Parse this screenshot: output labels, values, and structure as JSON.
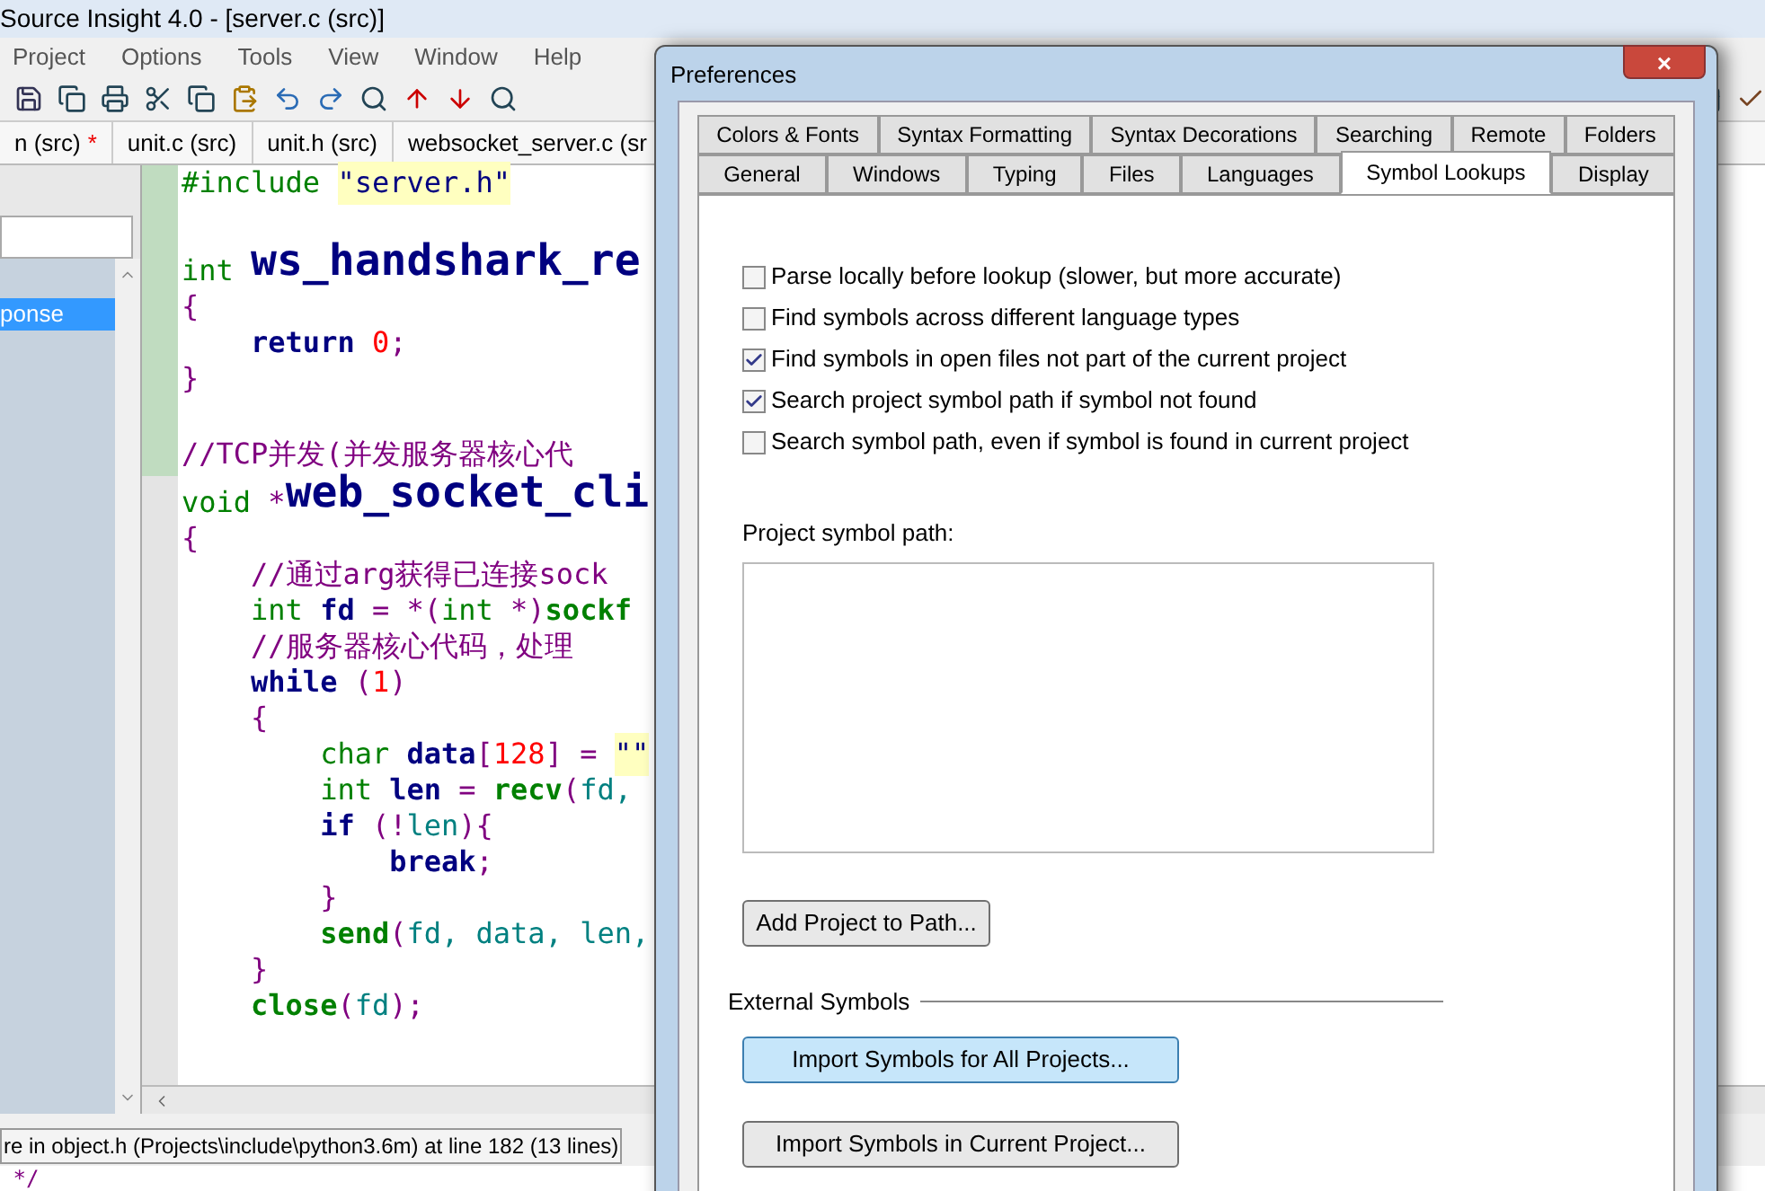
{
  "app": {
    "title": "Source Insight 4.0 - [server.c (src)]",
    "menu": [
      "Project",
      "Options",
      "Tools",
      "View",
      "Window",
      "Help"
    ],
    "file_tabs": [
      {
        "label": "n (src)",
        "marker": "*"
      },
      {
        "label": "unit.c (src)"
      },
      {
        "label": "unit.h (src)"
      },
      {
        "label": "websocket_server.c (sr"
      }
    ],
    "symbol_list": [
      {
        "label": "ponse",
        "selected": true
      }
    ],
    "code_lines": [
      {
        "segments": [
          {
            "kind": "keyword",
            "text": "#include "
          },
          {
            "kind": "string",
            "text": "\"server.h\""
          }
        ]
      },
      {
        "kind": "blank"
      },
      {
        "segments": [
          {
            "kind": "keyword",
            "text": "int "
          },
          {
            "kind": "function",
            "text": "ws_handshark_re"
          }
        ]
      },
      {
        "segments": [
          {
            "kind": "punct",
            "text": "{"
          }
        ]
      },
      {
        "segments": [
          {
            "kind": "bold",
            "text": "    return "
          },
          {
            "kind": "number",
            "text": "0"
          },
          {
            "kind": "punct",
            "text": ";"
          }
        ]
      },
      {
        "segments": [
          {
            "kind": "punct",
            "text": "}"
          }
        ]
      },
      {
        "kind": "blank"
      },
      {
        "segments": [
          {
            "kind": "comment",
            "text": "//TCP并发(并发服务器核心代"
          }
        ]
      },
      {
        "segments": [
          {
            "kind": "keyword",
            "text": "void "
          },
          {
            "kind": "punct",
            "text": "*"
          },
          {
            "kind": "function",
            "text": "web_socket_cli"
          }
        ]
      },
      {
        "segments": [
          {
            "kind": "punct",
            "text": "{"
          }
        ]
      },
      {
        "segments": [
          {
            "kind": "comment",
            "text": "    //通过arg获得已连接sock"
          }
        ]
      },
      {
        "segments": [
          {
            "kind": "keyword",
            "text": "    int "
          },
          {
            "kind": "bold",
            "text": "fd"
          },
          {
            "kind": "punct",
            "text": " = *("
          },
          {
            "kind": "keyword",
            "text": "int "
          },
          {
            "kind": "punct",
            "text": "*)"
          },
          {
            "kind": "call",
            "text": "sockf"
          }
        ]
      },
      {
        "segments": [
          {
            "kind": "comment",
            "text": "    //服务器核心代码，处理"
          }
        ]
      },
      {
        "segments": [
          {
            "kind": "bold",
            "text": "    while "
          },
          {
            "kind": "punct",
            "text": "("
          },
          {
            "kind": "number",
            "text": "1"
          },
          {
            "kind": "punct",
            "text": ")"
          }
        ]
      },
      {
        "segments": [
          {
            "kind": "punct",
            "text": "    {"
          }
        ]
      },
      {
        "segments": [
          {
            "kind": "keyword",
            "text": "        char "
          },
          {
            "kind": "bold",
            "text": "data"
          },
          {
            "kind": "punct",
            "text": "["
          },
          {
            "kind": "number",
            "text": "128"
          },
          {
            "kind": "punct",
            "text": "] = "
          },
          {
            "kind": "string",
            "text": "\"\""
          }
        ]
      },
      {
        "segments": [
          {
            "kind": "keyword",
            "text": "        int "
          },
          {
            "kind": "bold",
            "text": "len"
          },
          {
            "kind": "punct",
            "text": " = "
          },
          {
            "kind": "call",
            "text": "recv"
          },
          {
            "kind": "punct",
            "text": "("
          },
          {
            "kind": "ident",
            "text": "fd,"
          }
        ]
      },
      {
        "segments": [
          {
            "kind": "bold",
            "text": "        if "
          },
          {
            "kind": "punct",
            "text": "(!"
          },
          {
            "kind": "ident",
            "text": "len"
          },
          {
            "kind": "punct",
            "text": "){"
          }
        ]
      },
      {
        "segments": [
          {
            "kind": "bold",
            "text": "            break"
          },
          {
            "kind": "punct",
            "text": ";"
          }
        ]
      },
      {
        "segments": [
          {
            "kind": "punct",
            "text": "        }"
          }
        ]
      },
      {
        "segments": [
          {
            "kind": "call",
            "text": "        send"
          },
          {
            "kind": "punct",
            "text": "("
          },
          {
            "kind": "ident",
            "text": "fd, data, len,"
          }
        ]
      },
      {
        "segments": [
          {
            "kind": "punct",
            "text": "    }"
          }
        ]
      },
      {
        "segments": [
          {
            "kind": "call",
            "text": "    close"
          },
          {
            "kind": "punct",
            "text": "("
          },
          {
            "kind": "ident",
            "text": "fd"
          },
          {
            "kind": "punct",
            "text": ");"
          }
        ]
      }
    ],
    "status_bar": "re in object.h (Projects\\include\\python3.6m) at line 182 (13 lines)",
    "bottom_line": " */"
  },
  "dialog": {
    "title": "Preferences",
    "close": "×",
    "tab_rows": [
      [
        {
          "label": "Colors & Fonts",
          "selected": false
        },
        {
          "label": "Syntax Formatting",
          "selected": false
        },
        {
          "label": "Syntax Decorations",
          "selected": false
        },
        {
          "label": "Searching",
          "selected": false
        },
        {
          "label": "Remote",
          "selected": false
        },
        {
          "label": "Folders",
          "selected": false
        }
      ],
      [
        {
          "label": "General",
          "selected": false
        },
        {
          "label": "Windows",
          "selected": false
        },
        {
          "label": "Typing",
          "selected": false
        },
        {
          "label": "Files",
          "selected": false
        },
        {
          "label": "Languages",
          "selected": false
        },
        {
          "label": "Symbol Lookups",
          "selected": true
        },
        {
          "label": "Display",
          "selected": false
        }
      ]
    ],
    "options": [
      {
        "label": "Parse locally before lookup (slower, but more accurate)",
        "checked": false
      },
      {
        "label": "Find symbols across different language types",
        "checked": false
      },
      {
        "label": "Find symbols in open files not part of the current project",
        "checked": true
      },
      {
        "label": "Search project symbol path if symbol not found",
        "checked": true
      },
      {
        "label": "Search symbol path, even if symbol is found in current project",
        "checked": false
      }
    ],
    "path_label": "Project symbol path:",
    "add_button": "Add Project to Path...",
    "external_label": "External Symbols",
    "import_buttons": [
      {
        "label": "Import Symbols for All Projects...",
        "focused": true
      },
      {
        "label": "Import Symbols in Current Project...",
        "focused": false
      }
    ]
  }
}
